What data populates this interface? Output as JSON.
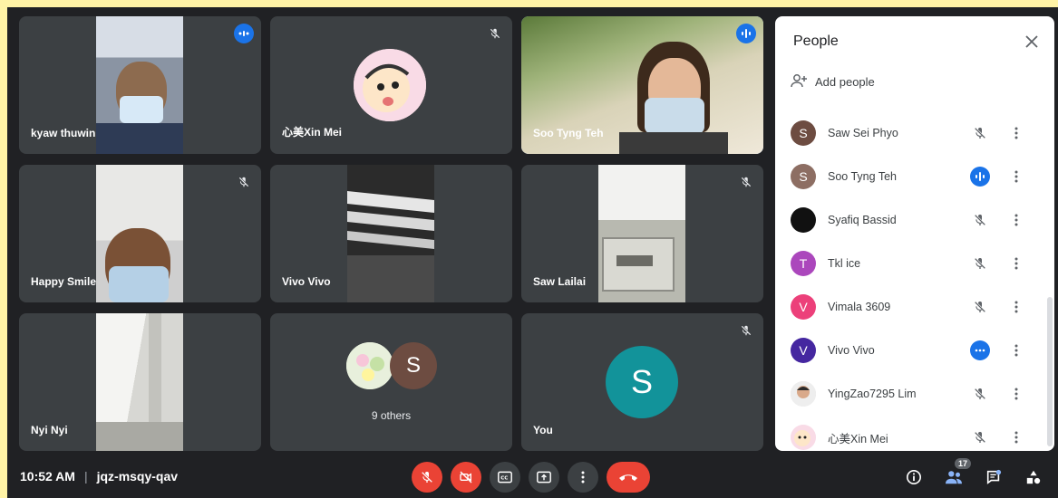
{
  "tiles": {
    "t1": {
      "name": "kyaw thuwin"
    },
    "t2": {
      "name": "心美Xin Mei"
    },
    "t3": {
      "name": "Soo Tyng Teh"
    },
    "t4": {
      "name": "Happy Smile"
    },
    "t5": {
      "name": "Vivo Vivo"
    },
    "t6": {
      "name": "Saw Lailai"
    },
    "t7": {
      "name": "Nyi Nyi"
    },
    "t8": {
      "others_label": "9 others",
      "avatar_letter": "S"
    },
    "t9": {
      "name": "You",
      "avatar_letter": "S"
    }
  },
  "bottom": {
    "time": "10:52 AM",
    "separator": "|",
    "meeting_code": "jqz-msqy-qav",
    "participant_count": "17"
  },
  "panel": {
    "title": "People",
    "add_people": "Add people",
    "people": [
      {
        "initial": "S",
        "name": "Saw Sei Phyo",
        "color": "#6d4c41",
        "status": "muted"
      },
      {
        "initial": "S",
        "name": "Soo Tyng Teh",
        "color": "#8d6e63",
        "status": "speaking"
      },
      {
        "initial": "",
        "name": "Syafiq Bassid",
        "color": "#111111",
        "status": "muted"
      },
      {
        "initial": "T",
        "name": "Tkl ice",
        "color": "#ab47bc",
        "status": "muted"
      },
      {
        "initial": "V",
        "name": "Vimala 3609",
        "color": "#ec407a",
        "status": "muted"
      },
      {
        "initial": "V",
        "name": "Vivo Vivo",
        "color": "#4527a0",
        "status": "talking-dots"
      },
      {
        "initial": "",
        "name": "YingZao7295 Lim",
        "color": "#e0e0e0",
        "status": "muted"
      },
      {
        "initial": "",
        "name": "心美Xin Mei",
        "color": "#f3e5f5",
        "status": "muted"
      }
    ]
  },
  "colors": {
    "accent": "#1a73e8",
    "end_call": "#ea4335",
    "tile_bg": "#3c4043",
    "frame": "#fff3a6"
  }
}
